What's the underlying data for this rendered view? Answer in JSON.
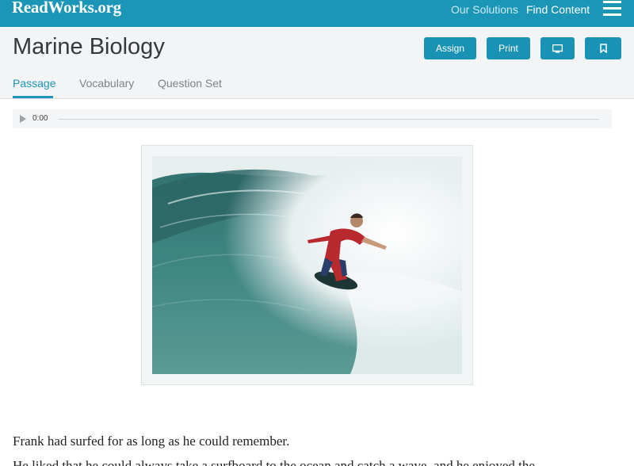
{
  "brand": {
    "logo_text": "ReadWorks.org"
  },
  "nav": {
    "our_solutions": "Our Solutions",
    "find_content": "Find Content"
  },
  "page": {
    "title": "Marine Biology"
  },
  "actions": {
    "assign": "Assign",
    "print": "Print"
  },
  "tabs": [
    {
      "label": "Passage",
      "active": true
    },
    {
      "label": "Vocabulary",
      "active": false
    },
    {
      "label": "Question Set",
      "active": false
    }
  ],
  "audio": {
    "time": "0:00"
  },
  "passage": {
    "first_line": "Frank had surfed for as long as he could remember.",
    "second_line": "He liked that he could always take a surfboard to the ocean and catch a wave, and he enjoyed the"
  },
  "colors": {
    "brand": "#1b96b6",
    "button": "#1992b3",
    "header_bg": "#f2f4f5"
  },
  "icons": [
    "menu-icon",
    "monitor-icon",
    "bookmark-icon",
    "play-icon"
  ]
}
